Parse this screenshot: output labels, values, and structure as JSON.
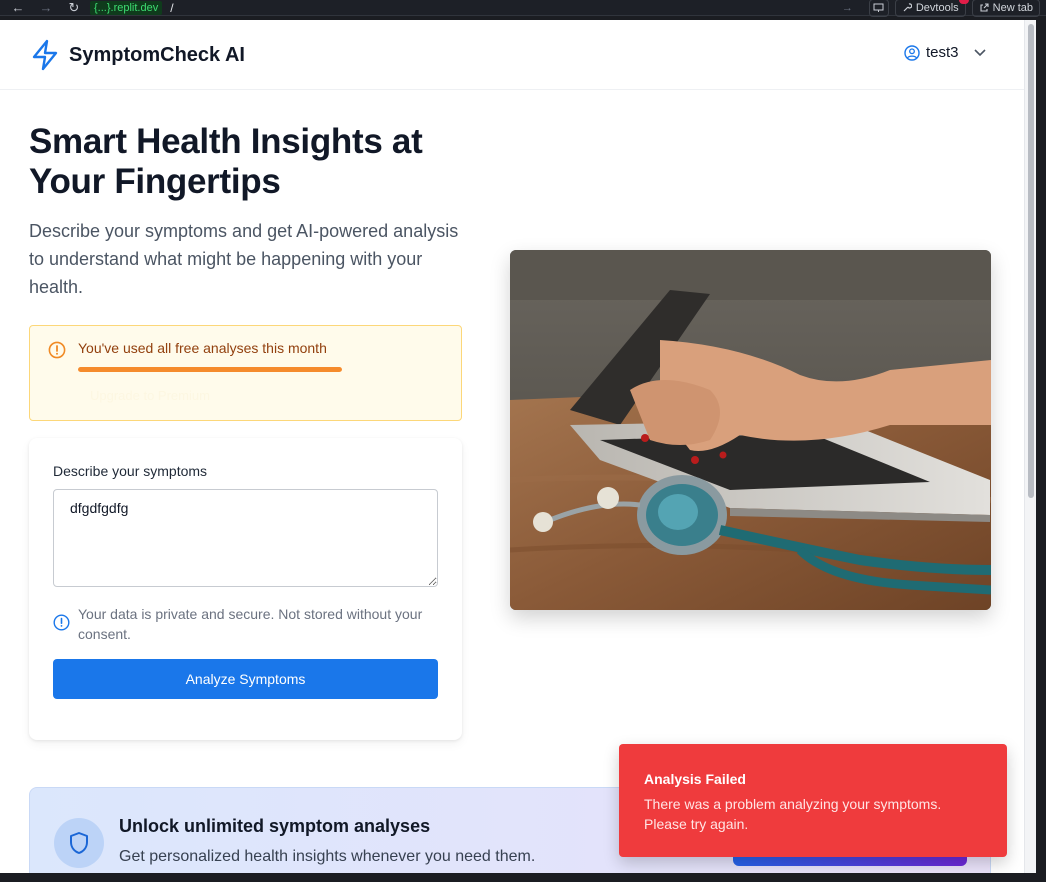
{
  "browser": {
    "back": "←",
    "forward": "→",
    "reload": "↻",
    "url_host": "{...}.replit.dev",
    "url_path": "/",
    "go_arrow": "→",
    "devtools_label": "Devtools",
    "new_tab_label": "New tab"
  },
  "header": {
    "brand": "SymptomCheck AI",
    "username": "test3"
  },
  "hero": {
    "title": "Smart Health Insights at Your Fingertips",
    "subtitle": "Describe your symptoms and get AI-powered analysis to understand what might be happening with your health."
  },
  "usage_warning": {
    "message": "You've used all free analyses this month",
    "usage_fraction": 1.0,
    "upgrade_link": "Upgrade to Premium"
  },
  "form": {
    "label": "Describe your symptoms",
    "symptoms_value": "dfgdfgdfg",
    "privacy_note": "Your data is private and secure. Not stored without your consent.",
    "submit_label": "Analyze Symptoms"
  },
  "upsell": {
    "title": "Unlock unlimited symptom analyses",
    "subtitle": "Get personalized health insights whenever you need them."
  },
  "toast": {
    "title": "Analysis Failed",
    "message": "There was a problem analyzing your symptoms. Please try again."
  },
  "colors": {
    "primary": "#1a77ea",
    "warning_bg": "#fffbeb",
    "warning_text": "#92400e",
    "progress": "#f58b2c",
    "toast_bg": "#ef3b3d"
  }
}
